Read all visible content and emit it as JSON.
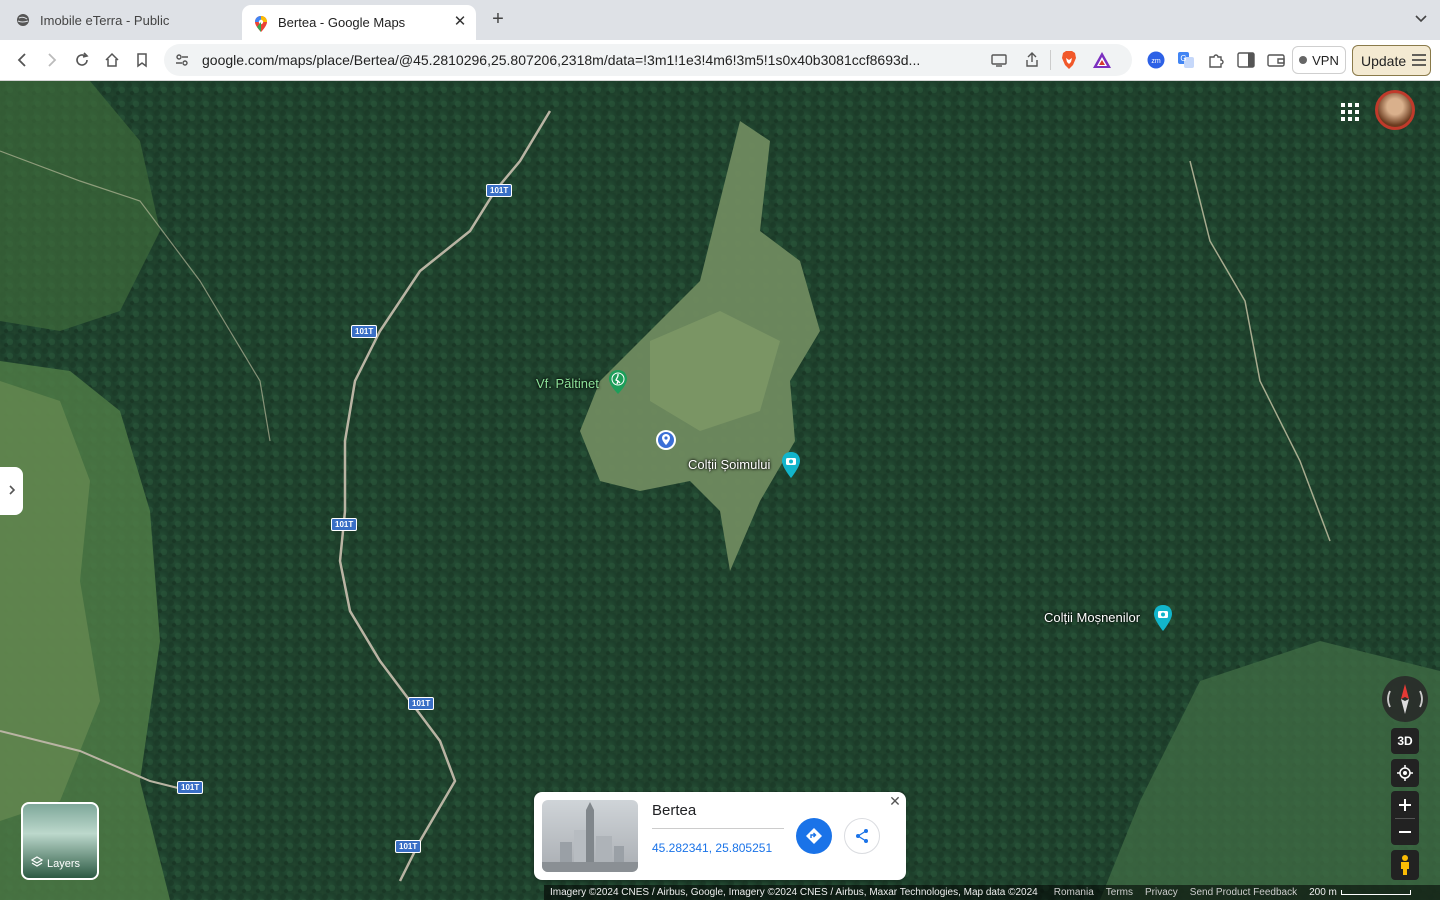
{
  "browser": {
    "tabs": [
      {
        "title": "Imobile eTerra - Public",
        "active": false
      },
      {
        "title": "Bertea - Google Maps",
        "active": true
      }
    ],
    "url": "google.com/maps/place/Bertea/@45.2810296,25.807206,2318m/data=!3m1!1e3!4m6!3m5!1s0x40b3081ccf8693d...",
    "vpn_label": "VPN",
    "update_label": "Update"
  },
  "map": {
    "road_shields": [
      "101T",
      "101T",
      "101T",
      "101T",
      "101T",
      "101T"
    ],
    "places": [
      {
        "name": "Vf. Păltinet",
        "type": "hiking"
      },
      {
        "name": "Colții Șoimului",
        "type": "photo"
      },
      {
        "name": "Colții Moșnenilor",
        "type": "photo"
      }
    ],
    "layers_label": "Layers",
    "three_d_label": "3D"
  },
  "card": {
    "title": "Bertea",
    "coords": "45.282341, 25.805251"
  },
  "footer": {
    "imagery": "Imagery ©2024 CNES / Airbus, Google, Imagery ©2024 CNES / Airbus, Maxar Technologies, Map data ©2024",
    "country": "Romania",
    "terms": "Terms",
    "privacy": "Privacy",
    "feedback": "Send Product Feedback",
    "scale": "200 m"
  },
  "colors": {
    "accent": "#1a73e8",
    "road_shield": "#3a6fc6",
    "forest": "#1f3a2a"
  }
}
